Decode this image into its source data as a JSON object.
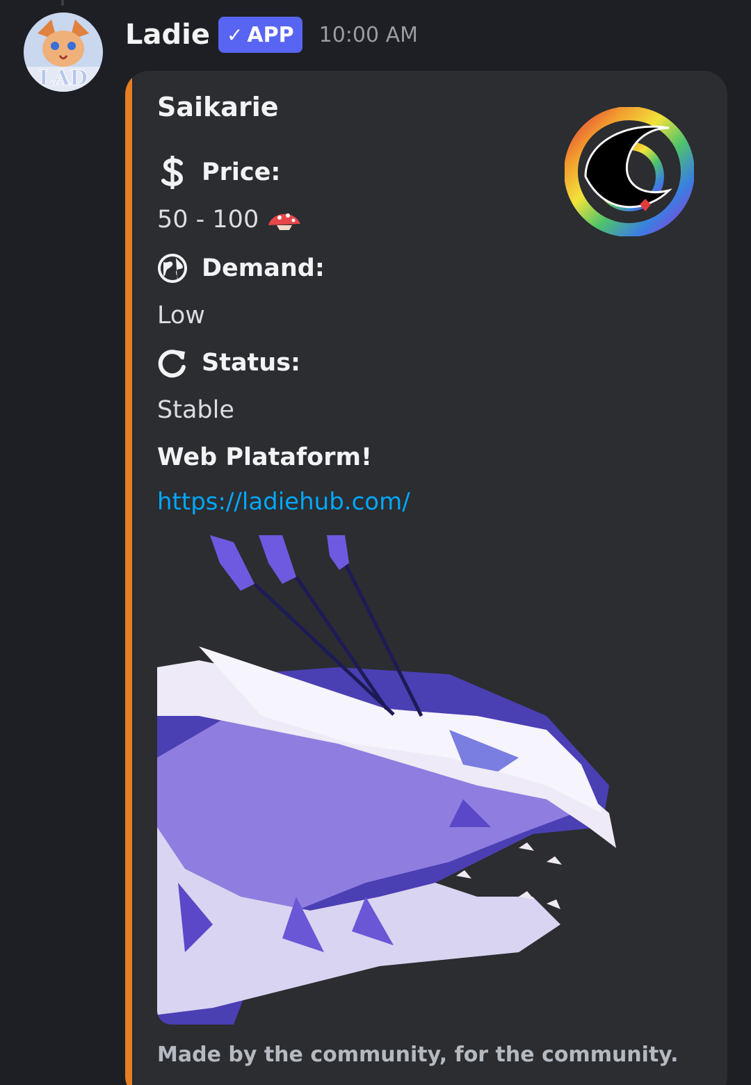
{
  "author": {
    "name": "Ladie",
    "badge": "APP",
    "timestamp": "10:00 AM",
    "avatar_text": "LAD"
  },
  "embed": {
    "accent_color": "#e67e22",
    "title": "Saikarie",
    "fields": [
      {
        "name": "Price:",
        "icon": "dollar-icon",
        "value": "50 - 100"
      },
      {
        "name": "Demand:",
        "icon": "globe-icon",
        "value": "Low"
      },
      {
        "name": "Status:",
        "icon": "refresh-icon",
        "value": "Stable"
      }
    ],
    "currency_icon": "mushroom-icon",
    "web_heading": "Web Plataform!",
    "link": "https://ladiehub.com/",
    "footer": "Made by the community, for the community."
  },
  "colors": {
    "background": "#1e1f24",
    "embed_background": "#2b2d31",
    "badge": "#5865f2",
    "link": "#00a8fc"
  }
}
